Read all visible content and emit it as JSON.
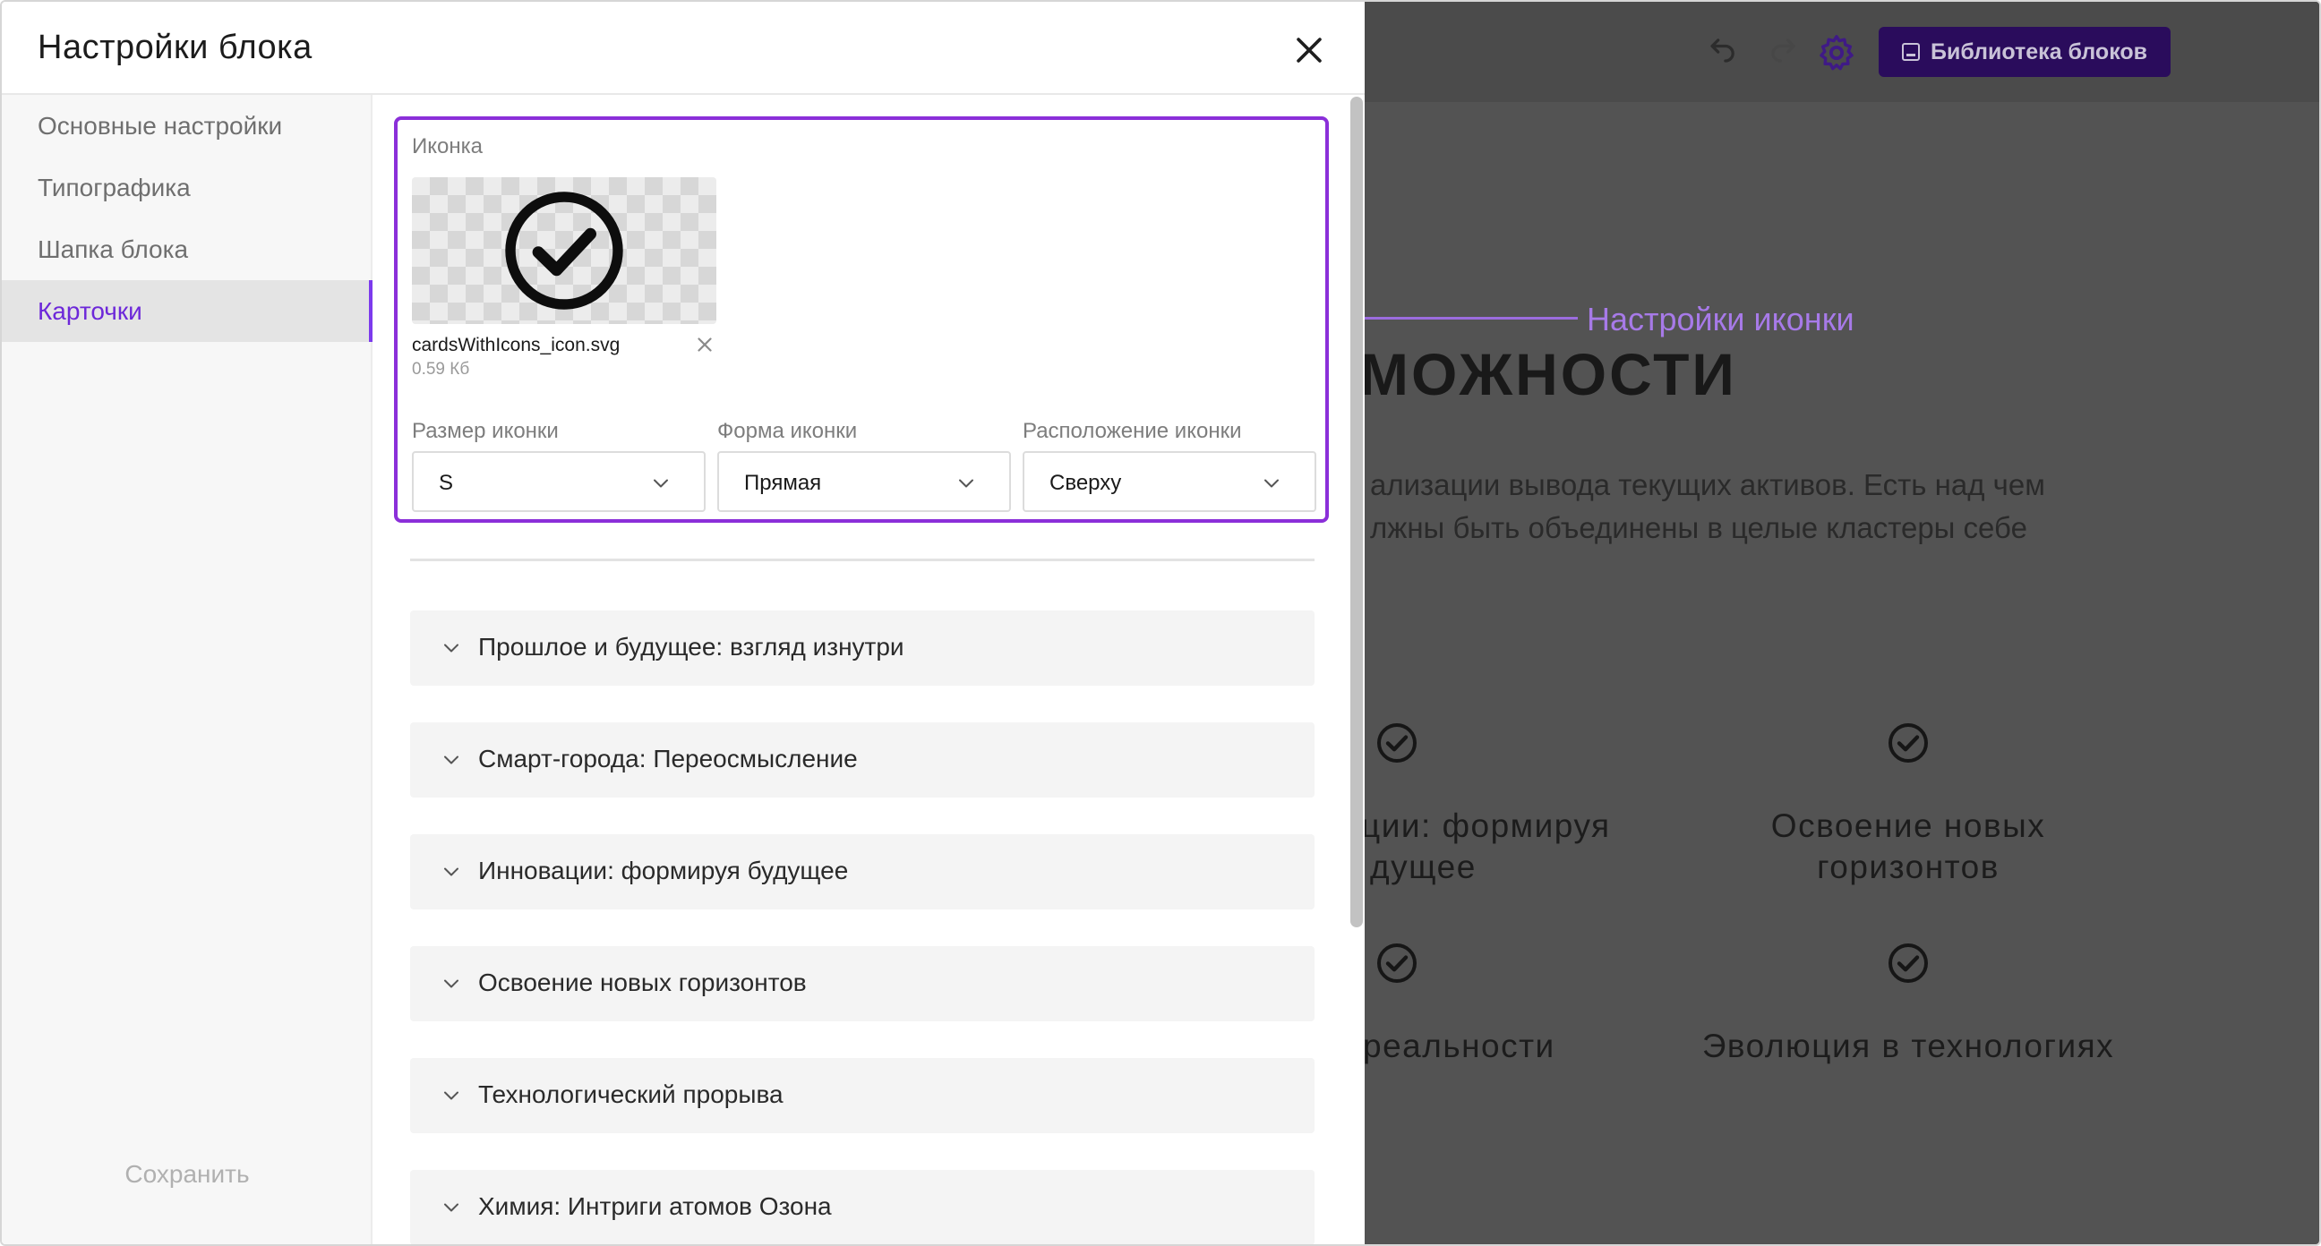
{
  "modal": {
    "title": "Настройки блока",
    "close_icon": "close-icon"
  },
  "sidebar": {
    "items": [
      {
        "label": "Основные настройки",
        "active": false
      },
      {
        "label": "Типографика",
        "active": false
      },
      {
        "label": "Шапка блока",
        "active": false
      },
      {
        "label": "Карточки",
        "active": true
      }
    ],
    "save_label": "Сохранить"
  },
  "icon_settings": {
    "section_label": "Иконка",
    "file_name": "cardsWithIcons_icon.svg",
    "file_size": "0.59 Кб",
    "fields": [
      {
        "label": "Размер иконки",
        "value": "S"
      },
      {
        "label": "Форма иконки",
        "value": "Прямая"
      },
      {
        "label": "Расположение иконки",
        "value": "Сверху"
      }
    ]
  },
  "cards": [
    {
      "title": "Прошлое и будущее: взгляд изнутри"
    },
    {
      "title": "Смарт-города: Переосмысление"
    },
    {
      "title": "Инновации: формируя будущее"
    },
    {
      "title": "Освоение новых горизонтов"
    },
    {
      "title": "Технологический прорыва"
    },
    {
      "title": "Химия: Интриги атомов Озона"
    }
  ],
  "annotation": {
    "text": "Настройки иконки"
  },
  "background_page": {
    "library_button": "Библиотека блоков",
    "heading_fragment": "МОЖНОСТИ",
    "paragraph_lines": [
      "ализации вывода текущих активов. Есть над чем",
      "лжны быть объединены в целые кластеры себе"
    ],
    "card_titles": [
      {
        "line1": "ции: формируя",
        "line2": "дущее"
      },
      {
        "line1": "Освоение новых",
        "line2": "горизонтов"
      },
      {
        "line1": "реальности",
        "line2": ""
      },
      {
        "line1": "Эволюция в технологиях",
        "line2": ""
      }
    ]
  },
  "colors": {
    "accent": "#7c3aed",
    "highlight_border": "#8b2fd9",
    "annotation": "#a77ae8",
    "overlay": "#535353",
    "library_button_bg": "#2a0c5c"
  }
}
